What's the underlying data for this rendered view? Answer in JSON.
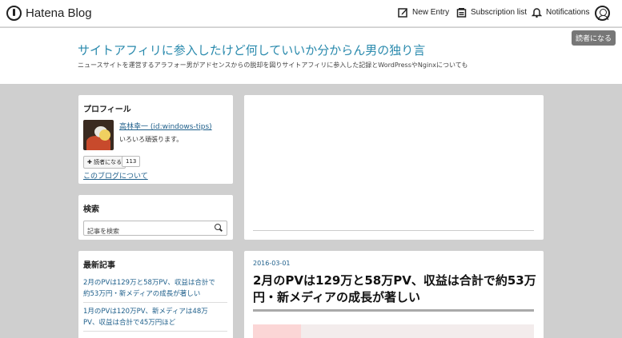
{
  "topbar": {
    "logo_text": "Hatena Blog",
    "new_entry": "New Entry",
    "subscription_list": "Subscription list",
    "notifications": "Notifications"
  },
  "header": {
    "subscribe_label": "読者になる",
    "blog_title": "サイトアフィリに参入したけど何していいか分からん男の独り言",
    "blog_description": "ニュースサイトを運営するアラフォー男がアドセンスからの脱却を図りサイトアフィリに参入した記録とWordPressやNginxについても"
  },
  "profile": {
    "heading": "プロフィール",
    "name": "高林幸一 (id:windows-tips)",
    "bio": "いろいろ頑張ります。",
    "readers_button": "✚ 読者になる",
    "readers_count": "113",
    "about_link": "このブログについて"
  },
  "search": {
    "heading": "検索",
    "placeholder": "記事を検索"
  },
  "recent": {
    "heading": "最新記事",
    "items": [
      {
        "line1": "2月のPVは129万と58万PV、収益は合計で",
        "line2": "約53万円・新メディアの成長が著しい"
      },
      {
        "line1": "1月のPVは120万PV、新メディアは48万",
        "line2": "PV、収益は合計で45万円ほど"
      }
    ]
  },
  "article": {
    "date": "2016-03-01",
    "title": "2月のPVは129万と58万PV、収益は合計で約53万円・新メディアの成長が著しい"
  },
  "colors": {
    "link": "#1d5e8a",
    "title": "#2a8aad",
    "background": "#cfcfcf"
  }
}
